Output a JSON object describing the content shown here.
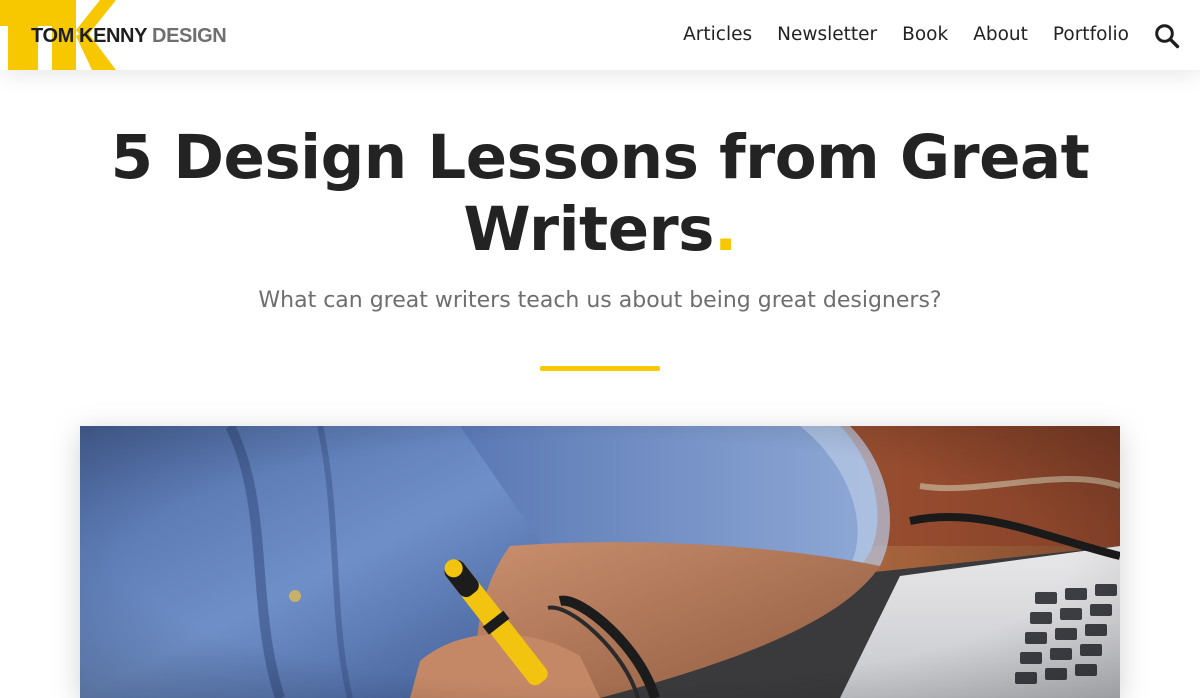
{
  "header": {
    "logo": {
      "monogram": "TK",
      "name": "TOM KENNY",
      "word": "DESIGN"
    },
    "nav": [
      {
        "label": "Articles"
      },
      {
        "label": "Newsletter"
      },
      {
        "label": "Book"
      },
      {
        "label": "About"
      },
      {
        "label": "Portfolio"
      }
    ],
    "search_icon": "search-icon"
  },
  "article": {
    "title": "5 Design Lessons from Great Writers",
    "title_dot": ".",
    "subtitle": "What can great writers teach us about being great designers?"
  },
  "hero_image": {
    "subject": "person-writing-with-pen-beside-laptop"
  },
  "colors": {
    "accent": "#f7c800",
    "text_dark": "#232323",
    "text_muted": "#6e6e6e"
  }
}
